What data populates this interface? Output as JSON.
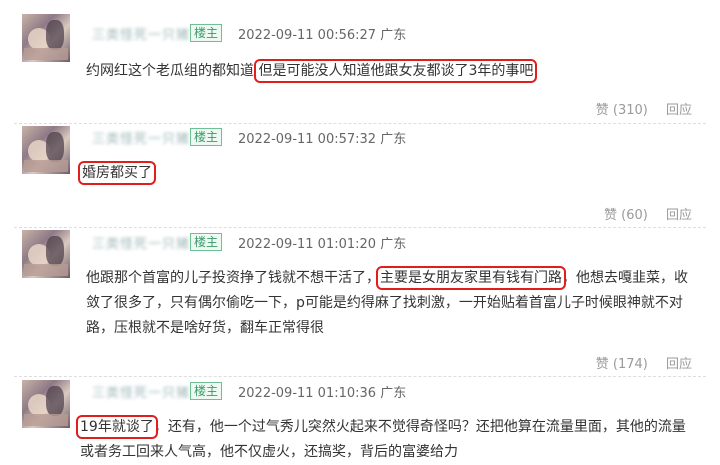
{
  "comments": [
    {
      "username": "三类怪死一只猪",
      "badge": "楼主",
      "date": "2022-09-11 00:56:27",
      "region": "广东",
      "text_before": "约网红这个老瓜组的都知道",
      "text_highlight": "但是可能没人知道他跟女友都谈了3年的事吧",
      "text_after": "",
      "likes": "赞 (310)",
      "reply": "回应"
    },
    {
      "username": "三类怪死一只猪",
      "badge": "楼主",
      "date": "2022-09-11 00:57:32",
      "region": "广东",
      "text_before": "",
      "text_highlight": "婚房都买了",
      "text_after": "",
      "likes": "赞 (60)",
      "reply": "回应"
    },
    {
      "username": "三类怪死一只猪",
      "badge": "楼主",
      "date": "2022-09-11 01:01:20",
      "region": "广东",
      "text_before": "他跟那个首富的儿子投资挣了钱就不想干活了，",
      "text_highlight": "主要是女朋友家里有钱有门路",
      "text_after": "，他想去嘎韭菜，收敛了很多了，只有偶尔偷吃一下，p可能是约得麻了找刺激，一开始贴着首富儿子时候眼神就不对路，压根就不是啥好货，翻车正常得很",
      "likes": "赞 (174)",
      "reply": "回应"
    },
    {
      "username": "三类怪死一只猪",
      "badge": "楼主",
      "date": "2022-09-11 01:10:36",
      "region": "广东",
      "text_before": "",
      "text_highlight": "19年就谈了",
      "text_after": "，还有，他一个过气秀儿突然火起来不觉得奇怪吗？还把他算在流量里面，其他的流量或者务工回来人气高，他不仅虚火，还搞奖，背后的富婆给力",
      "likes": "",
      "reply": ""
    }
  ]
}
